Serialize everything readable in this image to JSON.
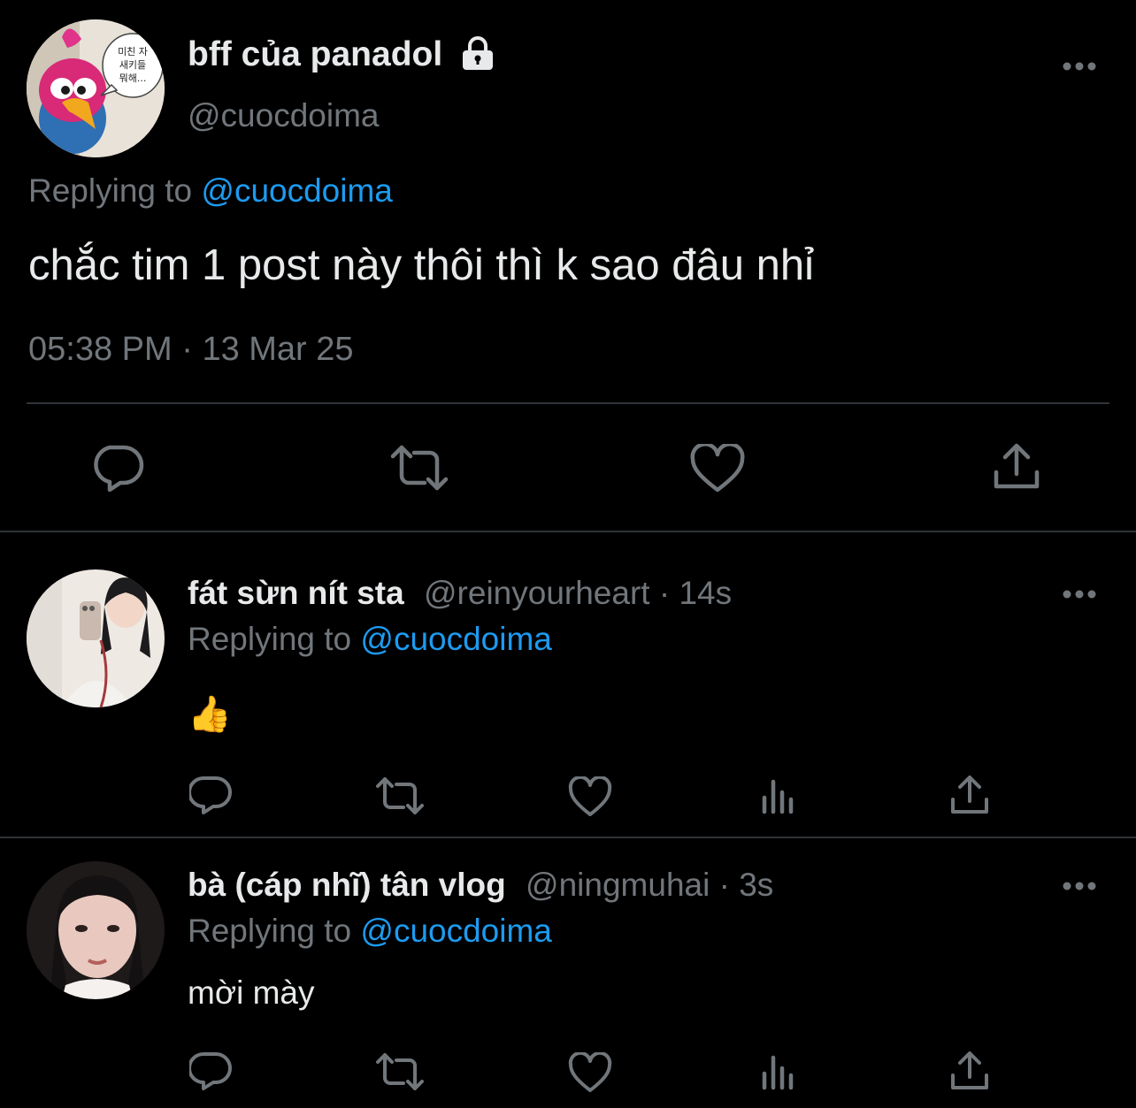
{
  "main_tweet": {
    "display_name": "bff của panadol",
    "handle": "@cuocdoima",
    "avatar_bubble_text": "미친 자 새키들 뭐해...",
    "replying_label": "Replying to",
    "replying_handle": "@cuocdoima",
    "text": "chắc tim 1 post này thôi thì k sao đâu nhỉ",
    "time": "05:38 PM",
    "separator": "·",
    "date": "13 Mar 25",
    "icons": [
      "lock-icon",
      "more-icon",
      "reply-icon",
      "retweet-icon",
      "like-icon",
      "share-icon"
    ]
  },
  "replies": [
    {
      "display_name": "fát sừn nít sta",
      "handle": "@reinyourheart",
      "time_ago": "· 14s",
      "replying_label": "Replying to",
      "replying_handle": "@cuocdoima",
      "text": "👍"
    },
    {
      "display_name": "bà (cáp nhĩ) tân vlog",
      "handle": "@ningmuhai",
      "time_ago": "· 3s",
      "replying_label": "Replying to",
      "replying_handle": "@cuocdoima",
      "text": "mời mày"
    }
  ],
  "reply_action_icons": [
    "reply-icon",
    "retweet-icon",
    "like-icon",
    "views-icon",
    "share-icon"
  ],
  "colors": {
    "background": "#000000",
    "primary_text": "#e7e9ea",
    "secondary_text": "#71767b",
    "link": "#1d9bf0",
    "divider": "#2f3336"
  }
}
